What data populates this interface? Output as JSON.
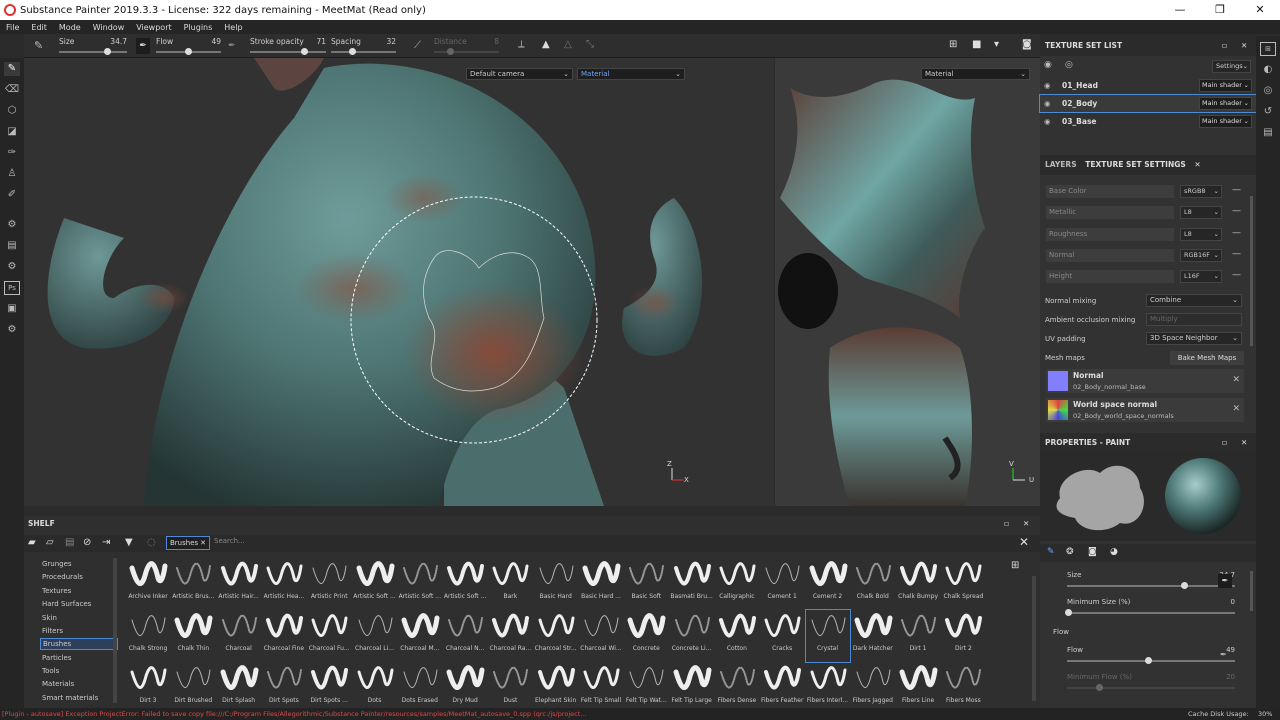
{
  "window": {
    "title": "Substance Painter 2019.3.3 - License: 322 days remaining - MeetMat (Read only)",
    "minimize": "—",
    "maximize": "❐",
    "close": "✕"
  },
  "menu": [
    "File",
    "Edit",
    "Mode",
    "Window",
    "Viewport",
    "Plugins",
    "Help"
  ],
  "toolbar": {
    "size": {
      "label": "Size",
      "value": "34.7",
      "fraction": 0.7
    },
    "flow": {
      "label": "Flow",
      "value": "49",
      "fraction": 0.49
    },
    "stroke_opacity": {
      "label": "Stroke opacity",
      "value": "71",
      "fraction": 0.71
    },
    "spacing": {
      "label": "Spacing",
      "value": "32",
      "fraction": 0.32
    },
    "distance": {
      "label": "Distance",
      "value": "8",
      "fraction": 0.25
    }
  },
  "viewport3d": {
    "camera_select": "Default camera",
    "channel_select": "Material"
  },
  "viewport2d": {
    "channel_select": "Material"
  },
  "texture_set_list": {
    "title": "TEXTURE SET LIST",
    "settings_label": "Settings",
    "items": [
      {
        "name": "01_Head",
        "shader": "Main shader"
      },
      {
        "name": "02_Body",
        "shader": "Main shader"
      },
      {
        "name": "03_Base",
        "shader": "Main shader"
      }
    ]
  },
  "texture_set_settings": {
    "tab_layers": "LAYERS",
    "tab_settings": "TEXTURE SET SETTINGS",
    "channels": [
      {
        "name": "Base Color",
        "format": "sRGB8"
      },
      {
        "name": "Metallic",
        "format": "L8"
      },
      {
        "name": "Roughness",
        "format": "L8"
      },
      {
        "name": "Normal",
        "format": "RGB16F"
      },
      {
        "name": "Height",
        "format": "L16F"
      }
    ],
    "normal_mixing": {
      "label": "Normal mixing",
      "value": "Combine"
    },
    "ao_mixing": {
      "label": "Ambient occlusion mixing",
      "value": "Multiply"
    },
    "uv_padding": {
      "label": "UV padding",
      "value": "3D Space Neighbor"
    },
    "mesh_maps_label": "Mesh maps",
    "bake_button": "Bake Mesh Maps",
    "mesh_maps": [
      {
        "title": "Normal",
        "file": "02_Body_normal_base",
        "color": "#8080ff"
      },
      {
        "title": "World space normal",
        "file": "02_Body_world_space_normals",
        "color": "#c06080"
      }
    ]
  },
  "properties": {
    "title": "PROPERTIES - PAINT",
    "size": {
      "label": "Size",
      "value": "34.7",
      "fraction": 0.7
    },
    "min_size": {
      "label": "Minimum Size (%)",
      "value": "0",
      "fraction": 0.0
    },
    "flow_section": "Flow",
    "flow": {
      "label": "Flow",
      "value": "49",
      "fraction": 0.49
    },
    "min_flow": {
      "label": "Minimum Flow (%)",
      "value": "20",
      "fraction": 0.2
    }
  },
  "shelf": {
    "title": "SHELF",
    "filter_tag": "Brushes",
    "search_placeholder": "Search...",
    "categories": [
      "Grunges",
      "Procedurals",
      "Textures",
      "Hard Surfaces",
      "Skin",
      "Filters",
      "Brushes",
      "Particles",
      "Tools",
      "Materials",
      "Smart materials"
    ],
    "selected_category": "Brushes",
    "brushes": [
      "Archive Inker",
      "Artistic Brus...",
      "Artistic Hair...",
      "Artistic Hea...",
      "Artistic Print",
      "Artistic Soft ...",
      "Artistic Soft ...",
      "Artistic Soft ...",
      "Bark",
      "Basic Hard",
      "Basic Hard ...",
      "Basic Soft",
      "Basmati Bru...",
      "Calligraphic",
      "Cement 1",
      "Cement 2",
      "Chalk Bold",
      "Chalk Bumpy",
      "Chalk Spread",
      "Chalk Strong",
      "Chalk Thin",
      "Charcoal",
      "Charcoal Fine",
      "Charcoal Fu...",
      "Charcoal Li...",
      "Charcoal M...",
      "Charcoal N...",
      "Charcoal Ra...",
      "Charcoal Str...",
      "Charcoal Wi...",
      "Concrete",
      "Concrete Li...",
      "Cotton",
      "Cracks",
      "Crystal",
      "Dark Hatcher",
      "Dirt 1",
      "Dirt 2",
      "Dirt 3",
      "Dirt Brushed",
      "Dirt Splash",
      "Dirt Spots",
      "Dirt Spots ...",
      "Dots",
      "Dots Erased",
      "Dry Mud",
      "Dust",
      "Elephant Skin",
      "Felt Tip Small",
      "Felt Tip Wat...",
      "Felt Tip Large",
      "Fibers Dense",
      "Fibers Feather",
      "Fibers Interl...",
      "Fibers Jagged",
      "Fibers Line",
      "Fibers Moss"
    ],
    "selected_brush": "Crystal"
  },
  "status": {
    "error": "[Plugin - autosave] Exception ProjectError: Failed to save copy file:///C:/Program Files/Allegorithmic/Substance Painter/resources/samples/MeetMat_autosave_0.spp (qrc:/js/project...",
    "cache_label": "Cache Disk Usage:",
    "cache_value": "30%"
  },
  "icons": {
    "eye": "eye-icon",
    "close": "close-icon",
    "dropdown": "chevron-down-icon"
  }
}
